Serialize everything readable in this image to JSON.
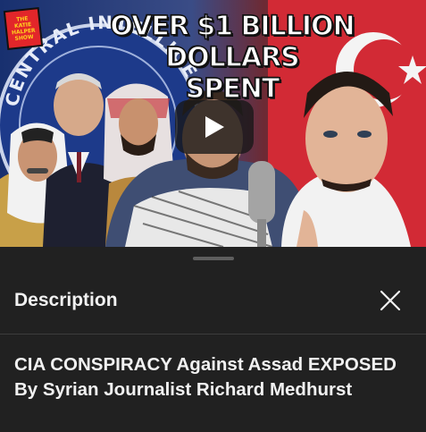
{
  "thumbnail": {
    "show_logo": "THE\nKATIE\nHALPER\nSHOW",
    "headline_line1": "OVER $1 BILLION DOLLARS",
    "headline_line2": "SPENT",
    "seal_text": "CENTRAL INTELLIGENCE",
    "colors": {
      "seal_blue": "#1d3a8a",
      "flag_red": "#d22a35",
      "logo_red": "#e2262a",
      "logo_yellow": "#ffd21f"
    }
  },
  "player": {
    "play_icon": "play-icon"
  },
  "sheet": {
    "title": "Description",
    "close_icon": "close-icon",
    "video_title": "CIA CONSPIRACY Against Assad EXPOSED By Syrian Journalist Richard Medhurst"
  },
  "colors": {
    "sheet_background": "#212121",
    "text_primary": "#f1f1f1",
    "divider": "#3d3d3d",
    "handle": "#5e5e5e"
  }
}
